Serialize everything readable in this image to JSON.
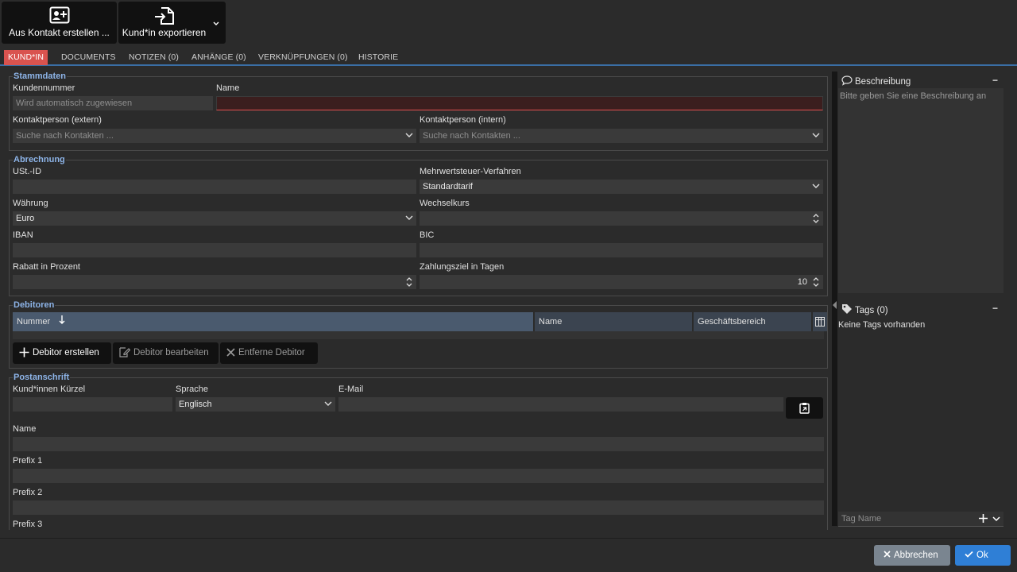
{
  "toolbar": {
    "create_from_contact": "Aus Kontakt erstellen ...",
    "export_customer": "Kund*in exportieren"
  },
  "tabs": [
    {
      "label": "KUND*IN"
    },
    {
      "label": "DOCUMENTS"
    },
    {
      "label": "NOTIZEN (0)"
    },
    {
      "label": "ANHÄNGE (0)"
    },
    {
      "label": "VERKNÜPFUNGEN (0)"
    },
    {
      "label": "HISTORIE"
    }
  ],
  "stammdaten": {
    "legend": "Stammdaten",
    "kundennummer_label": "Kundennummer",
    "kundennummer_placeholder": "Wird automatisch zugewiesen",
    "name_label": "Name",
    "name_value": "",
    "kontakt_extern_label": "Kontaktperson (extern)",
    "kontakt_extern_placeholder": "Suche nach Kontakten ...",
    "kontakt_intern_label": "Kontaktperson (intern)",
    "kontakt_intern_placeholder": "Suche nach Kontakten ..."
  },
  "abrechnung": {
    "legend": "Abrechnung",
    "ustid_label": "USt.-ID",
    "ustid_value": "",
    "mwst_label": "Mehrwertsteuer-Verfahren",
    "mwst_value": "Standardtarif",
    "waehrung_label": "Währung",
    "waehrung_value": "Euro",
    "wechselkurs_label": "Wechselkurs",
    "wechselkurs_value": "",
    "iban_label": "IBAN",
    "iban_value": "",
    "bic_label": "BIC",
    "bic_value": "",
    "rabatt_label": "Rabatt in Prozent",
    "rabatt_value": "",
    "zahlungsziel_label": "Zahlungsziel in Tagen",
    "zahlungsziel_value": "10"
  },
  "debitoren": {
    "legend": "Debitoren",
    "columns": [
      "Nummer",
      "Name",
      "Geschäftsbereich"
    ],
    "create_btn": "Debitor erstellen",
    "edit_btn": "Debitor bearbeiten",
    "remove_btn": "Entferne Debitor"
  },
  "postanschrift": {
    "legend": "Postanschrift",
    "kuerzel_label": "Kund*innen Kürzel",
    "kuerzel_value": "",
    "sprache_label": "Sprache",
    "sprache_value": "Englisch",
    "email_label": "E-Mail",
    "email_value": "",
    "name_label": "Name",
    "name_value": "",
    "prefix1_label": "Prefix 1",
    "prefix1_value": "",
    "prefix2_label": "Prefix 2",
    "prefix2_value": "",
    "prefix3_label": "Prefix 3"
  },
  "side": {
    "beschreibung_title": "Beschreibung",
    "beschreibung_placeholder": "Bitte geben Sie eine Beschreibung an",
    "tags_title": "Tags (0)",
    "tags_empty": "Keine Tags vorhanden",
    "tag_name_placeholder": "Tag Name",
    "minimize": "−"
  },
  "footer": {
    "cancel": "Abbrechen",
    "ok": "Ok"
  },
  "colors": {
    "active_tab": "#d9534f",
    "accent_blue": "#3a6ea5",
    "ok_button": "#2f7fd6",
    "cancel_button": "#7a8590"
  }
}
